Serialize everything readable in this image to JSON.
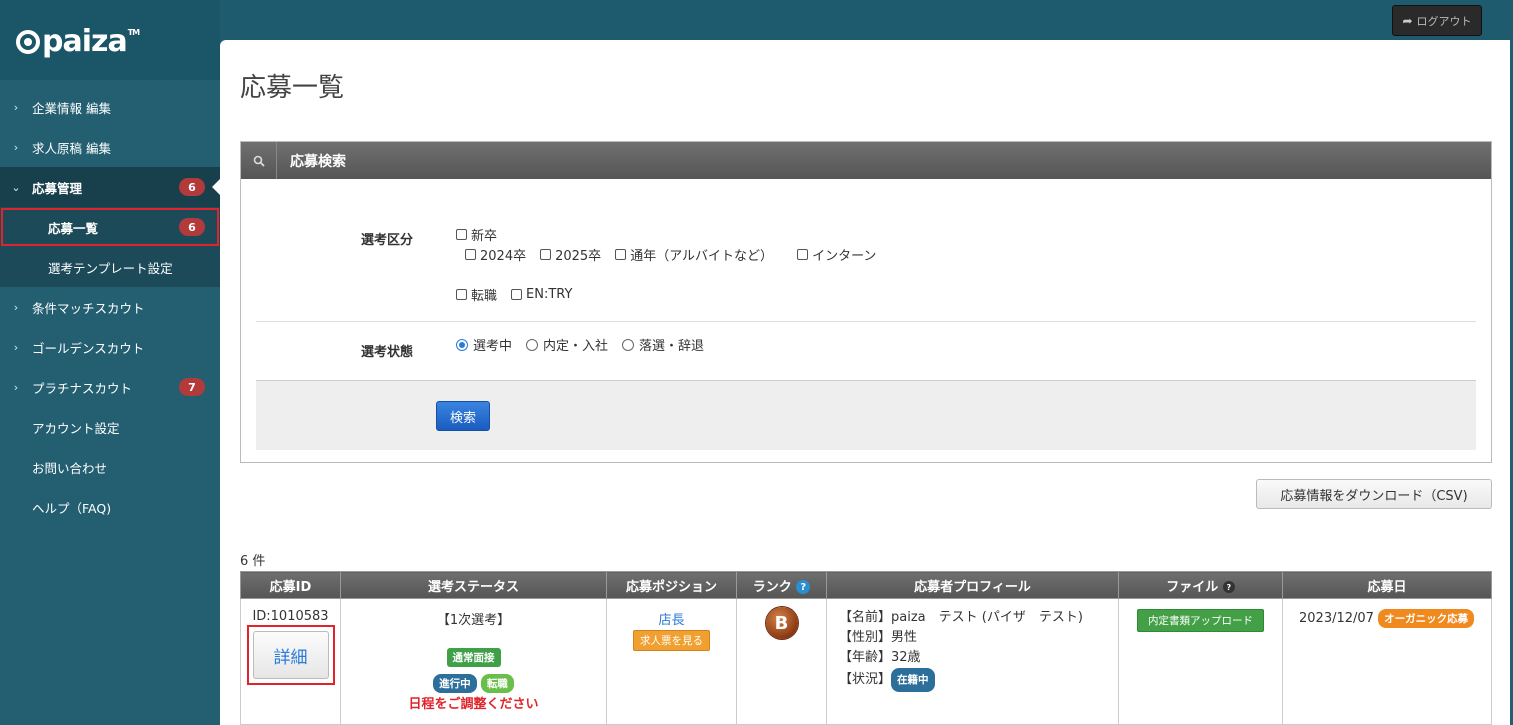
{
  "brand": {
    "logo_text": "paiza",
    "tm": "TM"
  },
  "topbar": {
    "logout_label": "ログアウト"
  },
  "sidebar": {
    "items": [
      {
        "label": "企業情報 編集"
      },
      {
        "label": "求人原稿 編集"
      },
      {
        "label": "応募管理",
        "badge": "6"
      },
      {
        "label": "応募一覧",
        "badge": "6"
      },
      {
        "label": "選考テンプレート設定"
      },
      {
        "label": "条件マッチスカウト"
      },
      {
        "label": "ゴールデンスカウト"
      },
      {
        "label": "プラチナスカウト",
        "badge": "7"
      },
      {
        "label": "アカウント設定"
      },
      {
        "label": "お問い合わせ"
      },
      {
        "label": "ヘルプ（FAQ)"
      }
    ]
  },
  "main": {
    "page_title": "応募一覧"
  },
  "search": {
    "title": "応募検索",
    "category_label": "選考区分",
    "category_options": {
      "new_grad": "新卒",
      "y2024": "2024卒",
      "y2025": "2025卒",
      "year_round": "通年（アルバイトなど）",
      "intern": "インターン",
      "career": "転職",
      "entry": "EN:TRY"
    },
    "status_label": "選考状態",
    "status_options": {
      "in_progress": "選考中",
      "offer": "内定・入社",
      "rejected": "落選・辞退"
    },
    "submit_label": "検索"
  },
  "csv_button": "応募情報をダウンロード（CSV)",
  "results": {
    "count_text": "6 件",
    "headers": {
      "id": "応募ID",
      "status": "選考ステータス",
      "position": "応募ポジション",
      "rank": "ランク",
      "profile": "応募者プロフィール",
      "file": "ファイル",
      "date": "応募日"
    },
    "rows": [
      {
        "id": "ID:1010583",
        "detail_label": "詳細",
        "stage": "【1次選考】",
        "interview_tag": "通常面接",
        "progress_tag": "進行中",
        "type_tag": "転職",
        "warning": "日程をご調整ください",
        "position": "店長",
        "job_link": "求人票を見る",
        "rank": "B",
        "profile": {
          "name": "【名前】paiza　テスト (パイザ　テスト)",
          "gender": "【性別】男性",
          "age": "【年齢】32歳",
          "status_label": "【状況】",
          "status_tag": "在籍中"
        },
        "file_button": "内定書類アップロード",
        "date": "2023/12/07",
        "source_tag": "オーガニック応募"
      }
    ]
  },
  "colors": {
    "sidebar_bg": "#235f71",
    "accent_red": "#e0242b",
    "link_blue": "#2a7ad8"
  }
}
